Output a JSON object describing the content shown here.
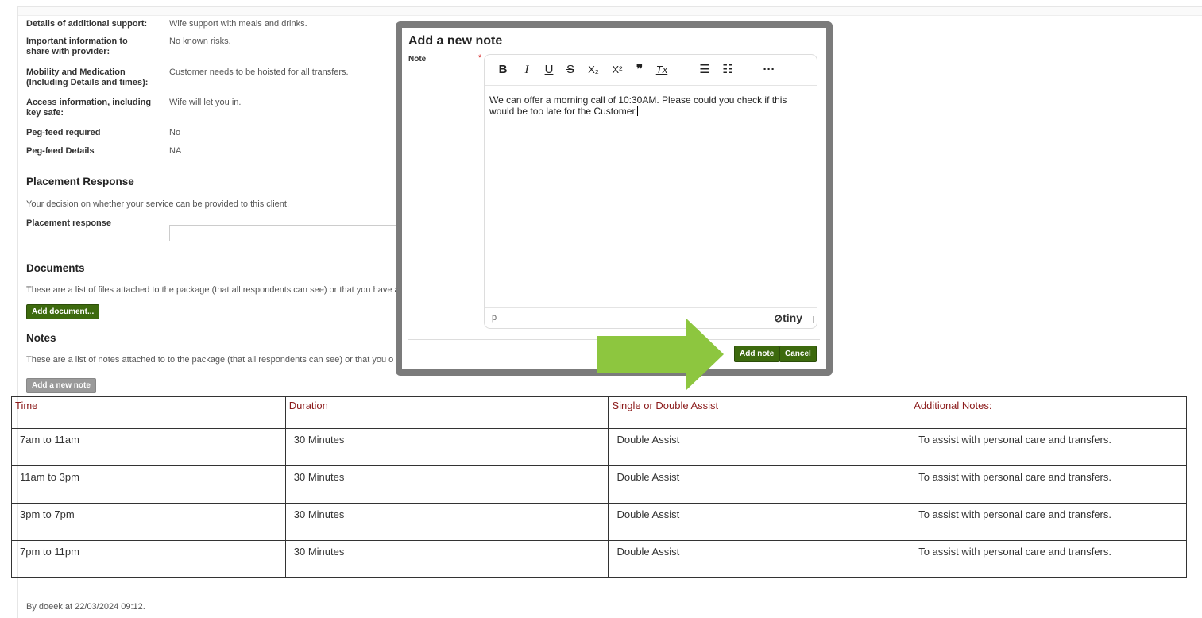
{
  "details": [
    {
      "label": "Details of additional support:",
      "value": "Wife support with meals and drinks."
    },
    {
      "label": "Important information to share with provider:",
      "value": "No known risks."
    },
    {
      "label": "Mobility and Medication (Including Details and times):",
      "value": "Customer needs to be hoisted for all transfers."
    },
    {
      "label": "Access information, including key safe:",
      "value": "Wife will let you in."
    },
    {
      "label": "Peg-feed required",
      "value": "No"
    },
    {
      "label": "Peg-feed Details",
      "value": "NA"
    }
  ],
  "placement": {
    "title": "Placement Response",
    "description": "Your decision on whether your service can be provided to this client.",
    "field_label": "Placement response",
    "field_value": ""
  },
  "documents": {
    "title": "Documents",
    "description": "These are a list of files attached to the package (that all respondents can see) or that you have a",
    "add_button": "Add document..."
  },
  "notes": {
    "title": "Notes",
    "description": "These are a list of notes attached to to the package (that all respondents can see) or that you o",
    "add_button": "Add a new note"
  },
  "table": {
    "headers": [
      "Time",
      "Duration",
      "Single or Double Assist",
      "Additional Notes:"
    ],
    "rows": [
      [
        "7am to 11am",
        "30 Minutes",
        "Double Assist",
        "To assist with personal care and transfers."
      ],
      [
        "11am to 3pm",
        "30 Minutes",
        "Double Assist",
        "To assist with personal care and transfers."
      ],
      [
        "3pm to 7pm",
        "30 Minutes",
        "Double Assist",
        "To assist with personal care and transfers."
      ],
      [
        "7pm to 11pm",
        "30 Minutes",
        "Double Assist",
        "To assist with personal care and transfers."
      ]
    ]
  },
  "footer": "By doeek at 22/03/2024 09:12.",
  "modal": {
    "title": "Add a new note",
    "note_label": "Note",
    "required_marker": "*",
    "toolbar": [
      {
        "icon": "bold-icon",
        "glyph": "B"
      },
      {
        "icon": "italic-icon",
        "glyph": "I"
      },
      {
        "icon": "underline-icon",
        "glyph": "U"
      },
      {
        "icon": "strikethrough-icon",
        "glyph": "S"
      },
      {
        "icon": "subscript-icon",
        "glyph": "X₂"
      },
      {
        "icon": "superscript-icon",
        "glyph": "X²"
      },
      {
        "icon": "blockquote-icon",
        "glyph": "❞"
      },
      {
        "icon": "clear-formatting-icon",
        "glyph": "Tx"
      },
      {
        "icon": "numbered-list-icon",
        "glyph": "☰"
      },
      {
        "icon": "bullet-list-icon",
        "glyph": "☷"
      },
      {
        "icon": "more-icon",
        "glyph": "···"
      }
    ],
    "body_text": "We can offer a morning call of 10:30AM. Please could you check if this would be too late for the Customer.",
    "status_path": "p",
    "brand": "tiny",
    "add_button": "Add note",
    "cancel_button": "Cancel"
  },
  "colors": {
    "primary_green": "#3d6a0e",
    "arrow_green": "#8dc63f",
    "header_text": "#8b1a1a",
    "modal_frame": "#7b7b7b"
  }
}
